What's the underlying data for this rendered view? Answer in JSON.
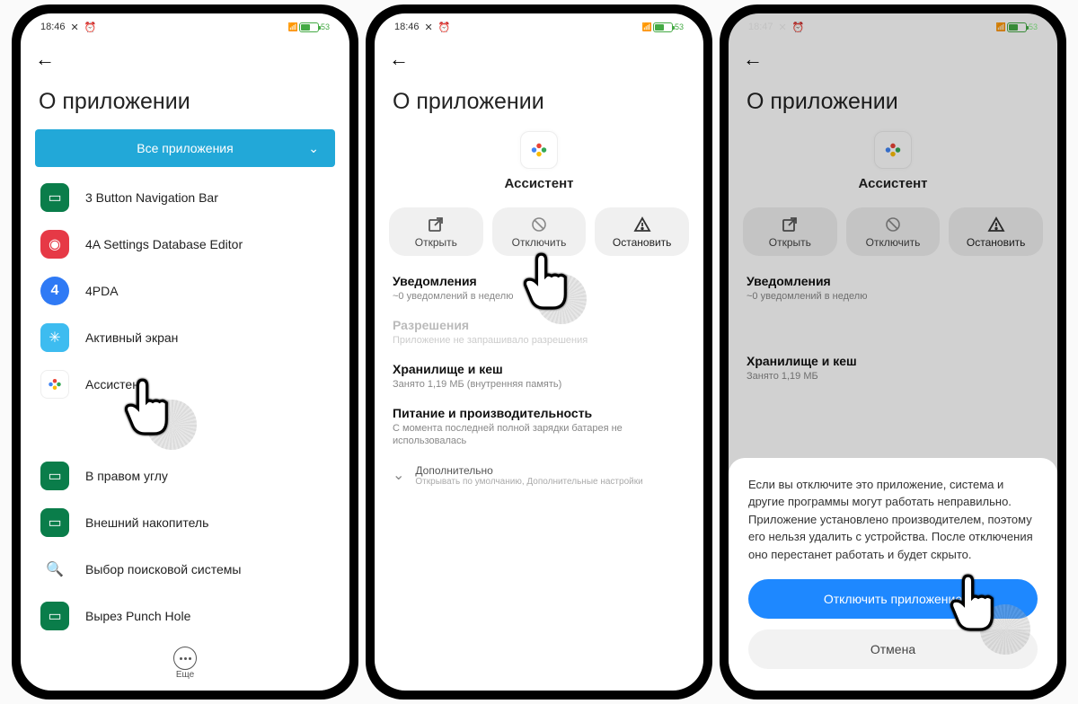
{
  "phone1": {
    "time": "18:46",
    "title": "О приложении",
    "filterLabel": "Все приложения",
    "apps": [
      {
        "label": "3 Button Navigation Bar"
      },
      {
        "label": "4A Settings Database Editor"
      },
      {
        "label": "4PDA"
      },
      {
        "label": "Активный экран"
      },
      {
        "label": "Ассистент"
      },
      {
        "label": "В правом углу"
      },
      {
        "label": "Внешний накопитель"
      },
      {
        "label": "Выбор поисковой системы"
      },
      {
        "label": "Вырез Punch Hole"
      }
    ],
    "moreLabel": "Еще"
  },
  "phone2": {
    "time": "18:46",
    "title": "О приложении",
    "appName": "Ассистент",
    "actions": {
      "open": "Открыть",
      "disable": "Отключить",
      "stop": "Остановить"
    },
    "notif": {
      "t": "Уведомления",
      "s": "~0 уведомлений в неделю"
    },
    "perm": {
      "t": "Разрешения",
      "s": "Приложение не запрашивало разрешения"
    },
    "storage": {
      "t": "Хранилище и кеш",
      "s": "Занято 1,19 МБ (внутренняя память)"
    },
    "power": {
      "t": "Питание и производительность",
      "s": "С момента последней полной зарядки батарея не использовалась"
    },
    "extra": {
      "t": "Дополнительно",
      "s": "Открывать по умолчанию, Дополнительные настройки"
    }
  },
  "phone3": {
    "time": "18:47",
    "title": "О приложении",
    "appName": "Ассистент",
    "actions": {
      "open": "Открыть",
      "disable": "Отключить",
      "stop": "Остановить"
    },
    "notif": {
      "t": "Уведомления",
      "s": "~0 уведомлений в неделю"
    },
    "storage": {
      "t": "Хранилище и кеш",
      "s": "Занято 1,19 МБ"
    },
    "sheet": {
      "text": "Если вы отключите это приложение, система и другие программы могут работать неправильно. Приложение установлено производителем, поэтому его нельзя удалить с устройства. После отключения оно перестанет работать и будет скрыто.",
      "primary": "Отключить приложение",
      "secondary": "Отмена"
    }
  },
  "battery": "53"
}
